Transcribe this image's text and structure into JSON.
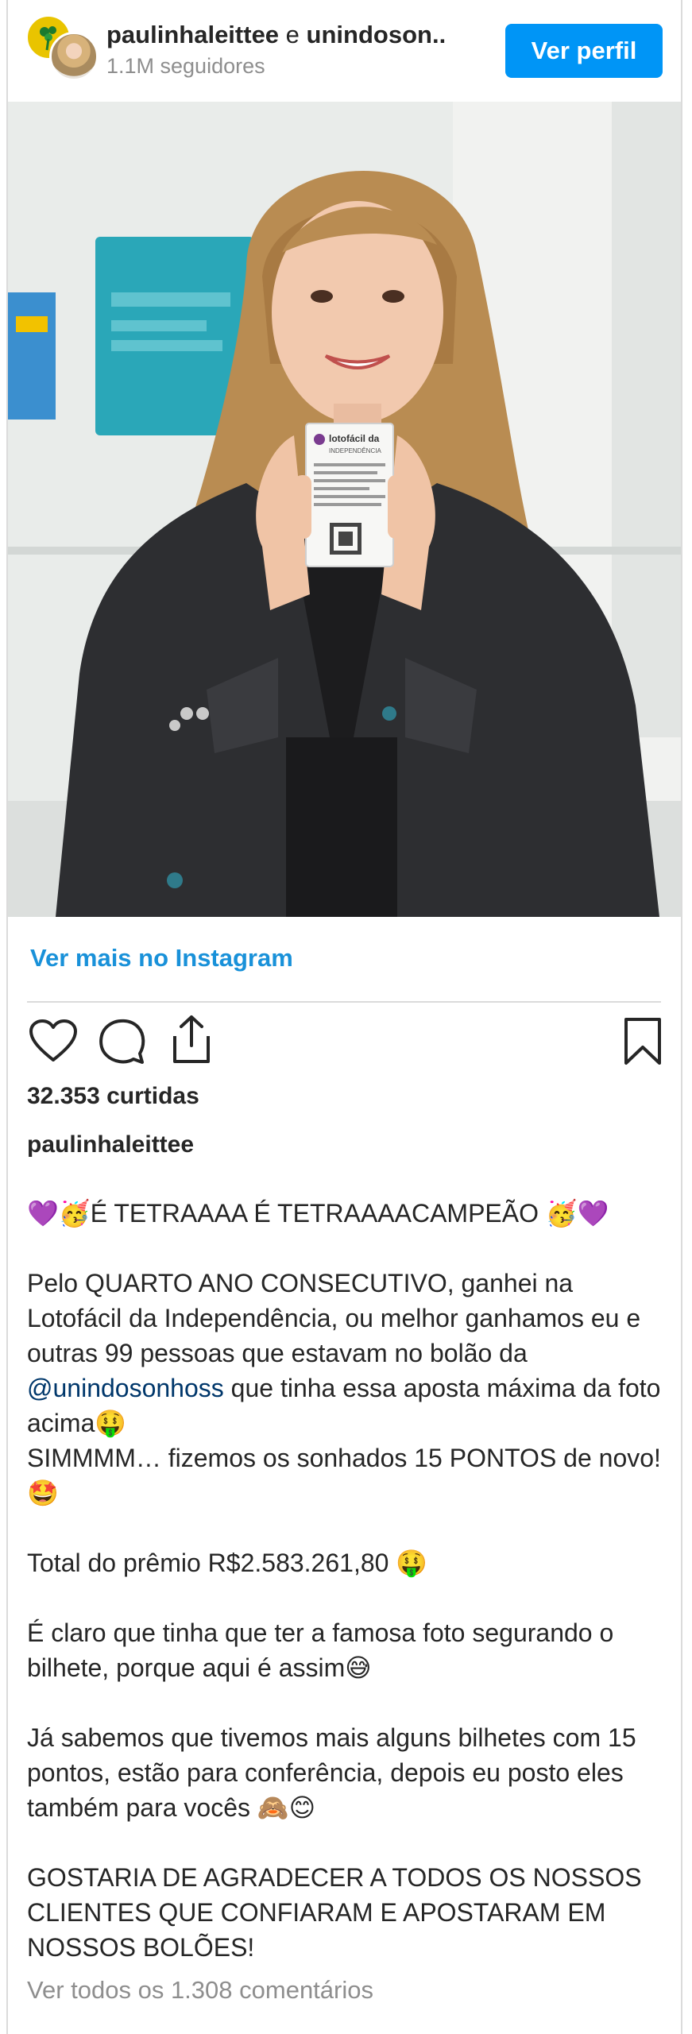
{
  "header": {
    "user1": "paulinhaleittee",
    "conj": "e",
    "user2": "unindoson..",
    "followers": "1.1M seguidores",
    "view_profile": "Ver perfil"
  },
  "ticket": {
    "brand": "lotofácil da",
    "sub": "INDEPENDÊNCIA"
  },
  "see_more": "Ver mais no Instagram",
  "likes": "32.353 curtidas",
  "author": "paulinhaleittee",
  "caption": {
    "line1": "💜🥳É TETRAAAA É TETRAAAACAMPEÃO 🥳💜",
    "p2_a": "Pelo QUARTO ANO CONSECUTIVO, ganhei na Lotofácil da Independência, ou melhor ganhamos eu e outras 99 pessoas que estavam no bolão da ",
    "p2_mention": "@unindosonhoss",
    "p2_b": " que tinha essa aposta máxima da foto acima🤑",
    "p2_c": "SIMMMM… fizemos os sonhados 15 PONTOS de novo! 🤩",
    "p3": "Total do prêmio R$2.583.261,80 🤑",
    "p4": "É claro que tinha que ter a famosa foto segurando o bilhete, porque aqui é assim😅",
    "p5": "Já sabemos que tivemos mais alguns bilhetes com 15 pontos, estão para conferência, depois eu posto eles também para vocês 🙈😊",
    "p6": "GOSTARIA DE AGRADECER A TODOS OS NOSSOS CLIENTES QUE CONFIARAM E APOSTARAM EM NOSSOS BOLÕES!"
  },
  "comments_link": "Ver todos os 1.308 comentários",
  "icons": [
    "heart-icon",
    "comment-icon",
    "share-icon",
    "bookmark-icon"
  ],
  "colors": {
    "accent": "#0095f6",
    "link": "#1991d9",
    "muted": "#8e8e8e",
    "avatar_brand": "#e9c400"
  }
}
